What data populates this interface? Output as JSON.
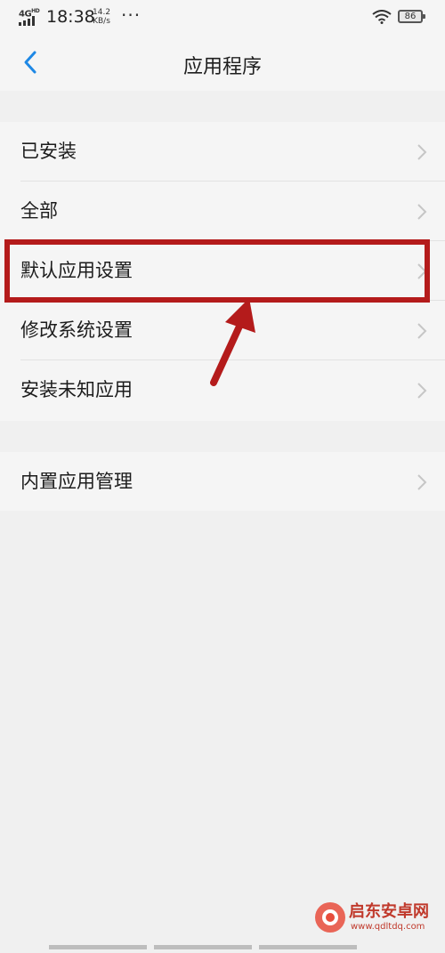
{
  "status_bar": {
    "network": "4G",
    "network_sup": "HD",
    "time": "18:38",
    "speed_value": "14.2",
    "speed_unit": "KB/s",
    "more": "···",
    "battery": "86"
  },
  "header": {
    "back_icon": "chevron-left-icon",
    "title": "应用程序"
  },
  "group1": [
    {
      "label": "已安装"
    },
    {
      "label": "全部"
    },
    {
      "label": "默认应用设置"
    },
    {
      "label": "修改系统设置"
    },
    {
      "label": "安装未知应用"
    }
  ],
  "group2": [
    {
      "label": "内置应用管理"
    }
  ],
  "watermark": {
    "title": "启东安卓网",
    "url": "www.qdltdq.com"
  },
  "colors": {
    "accent": "#1e88e5",
    "highlight": "#b41b1b",
    "background": "#f0f0f0",
    "surface": "#f5f5f5"
  }
}
